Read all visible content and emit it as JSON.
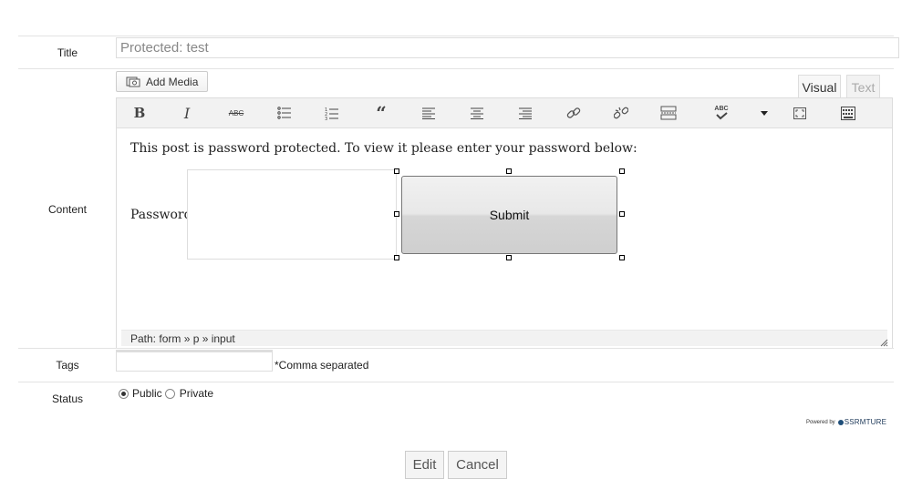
{
  "form": {
    "title_label": "Title",
    "title_value": "Protected: test",
    "content_label": "Content",
    "tags_label": "Tags",
    "tags_hint": "*Comma separated",
    "status_label": "Status",
    "status_options": [
      "Public",
      "Private"
    ],
    "status_selected": "Public"
  },
  "editor": {
    "add_media_label": "Add Media",
    "tabs": {
      "visual": "Visual",
      "text": "Text"
    },
    "active_tab": "Visual",
    "toolbar_icons": [
      "bold-icon",
      "italic-icon",
      "strikethrough-icon",
      "bullet-list-icon",
      "numbered-list-icon",
      "blockquote-icon",
      "align-left-icon",
      "align-center-icon",
      "align-right-icon",
      "link-icon",
      "unlink-icon",
      "read-more-icon",
      "spellcheck-icon",
      "dropdown-arrow-icon",
      "fullscreen-icon",
      "kitchen-sink-icon"
    ],
    "toolbar_glyphs": {
      "bold": "B",
      "italic": "I",
      "strike": "ABC",
      "blockquote": "“",
      "spell": "ABC"
    },
    "content": {
      "message": "This post is password protected. To view it please enter your password below:",
      "password_label": "Password:",
      "submit_label": "Submit"
    },
    "path_label": "Path: form » p » input"
  },
  "footer": {
    "powered_by": "Powered by",
    "brand": "SSRMTURE",
    "edit_label": "Edit",
    "cancel_label": "Cancel"
  }
}
